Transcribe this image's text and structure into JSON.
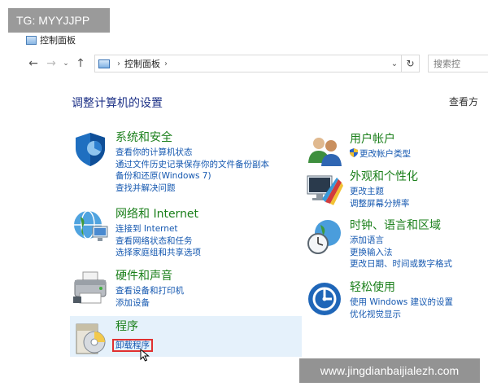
{
  "watermarks": {
    "top": "TG: MYYJJPP",
    "bottom": "www.jingdianbaijialezh.com"
  },
  "window": {
    "title": "控制面板"
  },
  "nav": {
    "back_icon": "←",
    "forward_icon": "→",
    "recent_icon": "⌄",
    "up_icon": "↑",
    "address_sep": "›",
    "address": "控制面板",
    "address_sep2": "›",
    "dropdown_icon": "⌄",
    "refresh_icon": "↻",
    "search_placeholder": "搜索控"
  },
  "main": {
    "heading": "调整计算机的设置",
    "view_by": "查看方"
  },
  "categories": [
    {
      "title": "系统和安全",
      "links": [
        "查看你的计算机状态",
        "通过文件历史记录保存你的文件备份副本",
        "备份和还原(Windows 7)",
        "查找并解决问题"
      ]
    },
    {
      "title": "网络和 Internet",
      "links": [
        "连接到 Internet",
        "查看网络状态和任务",
        "选择家庭组和共享选项"
      ]
    },
    {
      "title": "硬件和声音",
      "links": [
        "查看设备和打印机",
        "添加设备"
      ]
    },
    {
      "title": "程序",
      "links": [
        "卸载程序"
      ]
    },
    {
      "title": "用户帐户",
      "links": [
        "更改帐户类型"
      ]
    },
    {
      "title": "外观和个性化",
      "links": [
        "更改主题",
        "调整屏幕分辨率"
      ]
    },
    {
      "title": "时钟、语言和区域",
      "links": [
        "添加语言",
        "更换输入法",
        "更改日期、时间或数字格式"
      ]
    },
    {
      "title": "轻松使用",
      "links": [
        "使用 Windows 建议的设置",
        "优化视觉显示"
      ]
    }
  ],
  "colors": {
    "category_title": "#1a7f1a",
    "link": "#1558b0",
    "heading": "#1e3287",
    "highlight_box": "#e03030",
    "hover_bg": "#e5f1fb"
  }
}
